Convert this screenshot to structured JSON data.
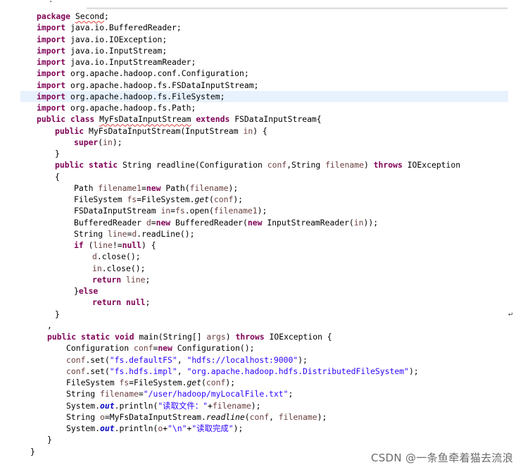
{
  "top_clipped_text": "- .   ·",
  "watermark": "CSDN @一条鱼牵着猫去流浪",
  "return_mark": "↵",
  "code_lines": [
    {
      "indent": 52,
      "tokens": [
        [
          "kw",
          "package "
        ],
        [
          "sq",
          "Second"
        ],
        [
          "",
          "; "
        ]
      ]
    },
    {
      "indent": 52,
      "tokens": [
        [
          "kw",
          "import "
        ],
        [
          "",
          "java.io.BufferedReader;"
        ]
      ]
    },
    {
      "indent": 52,
      "tokens": [
        [
          "kw",
          "import "
        ],
        [
          "",
          "java.io.IOException;"
        ]
      ]
    },
    {
      "indent": 52,
      "tokens": [
        [
          "kw",
          "import "
        ],
        [
          "",
          "java.io.InputStream;"
        ]
      ]
    },
    {
      "indent": 52,
      "tokens": [
        [
          "kw",
          "import "
        ],
        [
          "",
          "java.io.InputStreamReader;"
        ]
      ]
    },
    {
      "indent": 52,
      "tokens": [
        [
          "kw",
          "import "
        ],
        [
          "",
          "org.apache.hadoop.conf.Configuration;"
        ]
      ]
    },
    {
      "indent": 52,
      "tokens": [
        [
          "kw",
          "import "
        ],
        [
          "",
          "org.apache.hadoop.fs.FSDataInputStream;"
        ]
      ]
    },
    {
      "indent": 52,
      "highlight": true,
      "tokens": [
        [
          "kw",
          "import "
        ],
        [
          "",
          "org.apache.hadoop.fs.FileSystem;"
        ]
      ]
    },
    {
      "indent": 52,
      "tokens": [
        [
          "kw",
          "import "
        ],
        [
          "",
          "org.apache.hadoop.fs.Path;"
        ]
      ]
    },
    {
      "indent": 52,
      "tokens": [
        [
          "kw",
          "public class "
        ],
        [
          "sq",
          "MyFsDataInputStream"
        ],
        [
          "",
          " "
        ],
        [
          "kw",
          "extends "
        ],
        [
          "",
          "FSDataInputStream{"
        ]
      ]
    },
    {
      "indent": 78,
      "tokens": [
        [
          "kw",
          "public "
        ],
        [
          "",
          "MyFsDataInputStream(InputStream "
        ],
        [
          "var",
          "in"
        ],
        [
          "",
          ") {"
        ]
      ]
    },
    {
      "indent": 105,
      "tokens": [
        [
          "kw",
          "super"
        ],
        [
          "",
          "("
        ],
        [
          "var",
          "in"
        ],
        [
          "",
          ");"
        ]
      ]
    },
    {
      "indent": 78,
      "tokens": [
        [
          "",
          "}"
        ]
      ]
    },
    {
      "indent": 78,
      "tokens": [
        [
          "kw",
          "public static "
        ],
        [
          "",
          "String readline(Configuration "
        ],
        [
          "var",
          "conf"
        ],
        [
          "",
          ",String "
        ],
        [
          "var",
          "filename"
        ],
        [
          "",
          ") "
        ],
        [
          "kw",
          "throws "
        ],
        [
          "",
          "IOException"
        ]
      ]
    },
    {
      "indent": 78,
      "tokens": [
        [
          "",
          "{"
        ]
      ]
    },
    {
      "indent": 105,
      "tokens": [
        [
          "",
          "Path "
        ],
        [
          "var",
          "filename1"
        ],
        [
          "",
          "="
        ],
        [
          "kw",
          "new "
        ],
        [
          "",
          "Path("
        ],
        [
          "var",
          "filename"
        ],
        [
          "",
          ");"
        ]
      ]
    },
    {
      "indent": 105,
      "tokens": [
        [
          "",
          "FileSystem "
        ],
        [
          "var",
          "fs"
        ],
        [
          "",
          "=FileSystem."
        ],
        [
          "mth",
          "get"
        ],
        [
          "",
          "("
        ],
        [
          "var",
          "conf"
        ],
        [
          "",
          ");"
        ]
      ]
    },
    {
      "indent": 105,
      "tokens": [
        [
          "",
          "FSDataInputStream "
        ],
        [
          "var",
          "in"
        ],
        [
          "",
          "="
        ],
        [
          "var",
          "fs"
        ],
        [
          "",
          ".open("
        ],
        [
          "var",
          "filename1"
        ],
        [
          "",
          ");"
        ]
      ]
    },
    {
      "indent": 105,
      "tokens": [
        [
          "",
          "BufferedReader "
        ],
        [
          "var",
          "d"
        ],
        [
          "",
          "="
        ],
        [
          "kw",
          "new "
        ],
        [
          "",
          "BufferedReader("
        ],
        [
          "kw",
          "new "
        ],
        [
          "",
          "InputStreamReader("
        ],
        [
          "var",
          "in"
        ],
        [
          "",
          "));"
        ]
      ]
    },
    {
      "indent": 105,
      "tokens": [
        [
          "",
          "String "
        ],
        [
          "var",
          "line"
        ],
        [
          "",
          "="
        ],
        [
          "var",
          "d"
        ],
        [
          "",
          ".readLine();"
        ]
      ]
    },
    {
      "indent": 105,
      "tokens": [
        [
          "kw",
          "if "
        ],
        [
          "",
          "("
        ],
        [
          "var",
          "line"
        ],
        [
          "",
          "!="
        ],
        [
          "kw",
          "null"
        ],
        [
          "",
          ") {"
        ]
      ]
    },
    {
      "indent": 131,
      "tokens": [
        [
          "var",
          "d"
        ],
        [
          "",
          ".close();"
        ]
      ]
    },
    {
      "indent": 131,
      "tokens": [
        [
          "var",
          "in"
        ],
        [
          "",
          ".close();"
        ]
      ]
    },
    {
      "indent": 131,
      "tokens": [
        [
          "kw",
          "return "
        ],
        [
          "var",
          "line"
        ],
        [
          "",
          ";"
        ]
      ]
    },
    {
      "indent": 105,
      "tokens": [
        [
          "",
          "}"
        ],
        [
          "kw",
          "else"
        ]
      ]
    },
    {
      "indent": 131,
      "tokens": [
        [
          "kw",
          "return null"
        ],
        [
          "",
          ";"
        ]
      ]
    },
    {
      "indent": 78,
      "return_mark": true,
      "tokens": [
        [
          "",
          "}"
        ]
      ]
    },
    {
      "indent": 67,
      "tokens": [
        [
          "",
          ","
        ]
      ]
    },
    {
      "indent": 67,
      "tokens": [
        [
          "kw",
          "public static void "
        ],
        [
          "",
          "main(String[] "
        ],
        [
          "var",
          "args"
        ],
        [
          "",
          ") "
        ],
        [
          "kw",
          "throws "
        ],
        [
          "",
          "IOException {"
        ]
      ]
    },
    {
      "indent": 94,
      "tokens": [
        [
          "",
          "Configuration "
        ],
        [
          "var",
          "conf"
        ],
        [
          "",
          "="
        ],
        [
          "kw",
          "new "
        ],
        [
          "",
          "Configuration();"
        ]
      ]
    },
    {
      "indent": 94,
      "tokens": [
        [
          "var",
          "conf"
        ],
        [
          "",
          ".set("
        ],
        [
          "str",
          "\"fs.defaultFS\""
        ],
        [
          "",
          ", "
        ],
        [
          "str",
          "\"hdfs://localhost:9000\""
        ],
        [
          "",
          ");"
        ]
      ]
    },
    {
      "indent": 94,
      "tokens": [
        [
          "var",
          "conf"
        ],
        [
          "",
          ".set("
        ],
        [
          "str",
          "\"fs.hdfs.impl\""
        ],
        [
          "",
          ", "
        ],
        [
          "str",
          "\"org.apache.hadoop.hdfs.DistributedFileSystem\""
        ],
        [
          "",
          ");"
        ]
      ]
    },
    {
      "indent": 94,
      "tokens": [
        [
          "",
          "FileSystem "
        ],
        [
          "var",
          "fs"
        ],
        [
          "",
          "=FileSystem."
        ],
        [
          "mth",
          "get"
        ],
        [
          "",
          "("
        ],
        [
          "var",
          "conf"
        ],
        [
          "",
          ");"
        ]
      ]
    },
    {
      "indent": 94,
      "tokens": [
        [
          "",
          "String "
        ],
        [
          "var",
          "filename"
        ],
        [
          "",
          "="
        ],
        [
          "str",
          "\"/user/hadoop/myLocalFile.txt\""
        ],
        [
          "",
          ";"
        ]
      ]
    },
    {
      "indent": 94,
      "tokens": [
        [
          "",
          "System."
        ],
        [
          "fld",
          "out"
        ],
        [
          "",
          ".println("
        ],
        [
          "str",
          "\"读取文件：\""
        ],
        [
          "",
          "+"
        ],
        [
          "var",
          "filename"
        ],
        [
          "",
          ");"
        ]
      ]
    },
    {
      "indent": 94,
      "tokens": [
        [
          "",
          "String "
        ],
        [
          "var",
          "o"
        ],
        [
          "",
          "=MyFsDataInputStream."
        ],
        [
          "mth",
          "readline"
        ],
        [
          "",
          "("
        ],
        [
          "var",
          "conf"
        ],
        [
          "",
          ", "
        ],
        [
          "var",
          "filename"
        ],
        [
          "",
          ");"
        ]
      ]
    },
    {
      "indent": 94,
      "tokens": [
        [
          "",
          "System."
        ],
        [
          "fld",
          "out"
        ],
        [
          "",
          ".println("
        ],
        [
          "var",
          "o"
        ],
        [
          "",
          "+"
        ],
        [
          "str",
          "\"\\n\""
        ],
        [
          "",
          "+"
        ],
        [
          "str",
          "\"读取完成\""
        ],
        [
          "",
          ");"
        ]
      ]
    },
    {
      "indent": 67,
      "tokens": [
        [
          "",
          "}"
        ]
      ]
    },
    {
      "indent": 43,
      "tokens": [
        [
          "",
          "}"
        ]
      ]
    }
  ]
}
